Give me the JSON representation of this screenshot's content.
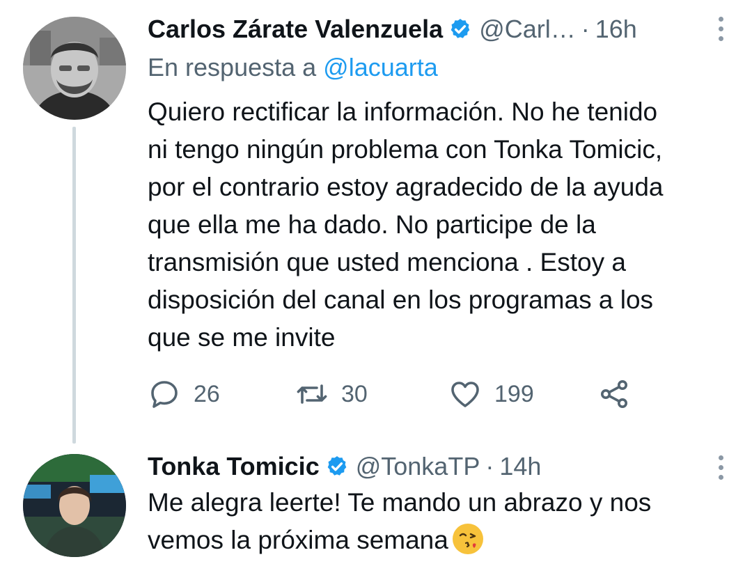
{
  "tweets": [
    {
      "author_name": "Carlos Zárate Valenzuela",
      "handle": "@Carl…",
      "separator": "·",
      "time": "16h",
      "reply_prefix": "En respuesta a",
      "reply_mention": "@lacuarta",
      "text": "Quiero rectificar la información. No he tenido\nni tengo ningún problema con Tonka Tomicic,\npor el contrario estoy agradecido de la ayuda\nque ella me ha dado. No participe de la\ntransmisión que usted menciona . Estoy a\ndisposición del canal en los programas a los\nque se me invite",
      "replies": "26",
      "retweets": "30",
      "likes": "199"
    },
    {
      "author_name": "Tonka Tomicic",
      "handle": "@TonkaTP",
      "separator": "·",
      "time": "14h",
      "text": "Me alegra leerte! Te mando un abrazo y nos\nvemos la próxima semana",
      "emoji": "kissing-face-with-heart-emoji"
    }
  ],
  "colors": {
    "accent": "#1d9bf0",
    "secondary_text": "#536471",
    "thread_line": "#cfd9de"
  },
  "icons": {
    "verified": "verified-badge-icon",
    "more": "more-vertical-icon",
    "reply": "reply-icon",
    "retweet": "retweet-icon",
    "like": "heart-icon",
    "share": "share-icon"
  }
}
